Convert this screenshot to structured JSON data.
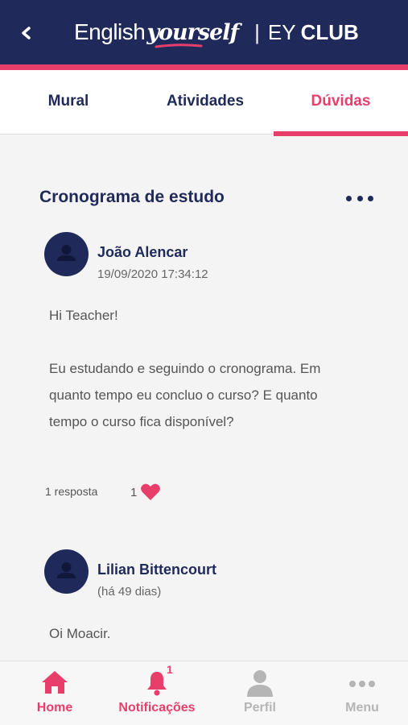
{
  "header": {
    "back_icon": "chevron-left-icon",
    "logo_english": "English",
    "logo_yourself": "yourself",
    "logo_separator": "|",
    "logo_ey": "EY",
    "logo_club": "CLUB"
  },
  "tabs": [
    {
      "label": "Mural",
      "active": false
    },
    {
      "label": "Atividades",
      "active": false
    },
    {
      "label": "Dúvidas",
      "active": true
    }
  ],
  "post": {
    "title": "Cronograma de estudo",
    "more_icon": "more-horizontal-icon",
    "author": "João Alencar",
    "timestamp": "19/09/2020 17:34:12",
    "greeting": "Hi Teacher!",
    "body_line1": "Eu estudando e seguindo o cronograma. Em",
    "body_line2": "quanto tempo eu concluo o curso? E quanto",
    "body_line3": "tempo o curso fica disponível?",
    "replies": "1 resposta",
    "likes": "1",
    "like_icon": "heart-icon"
  },
  "reply": {
    "author": "Lilian Bittencourt",
    "timestamp": "(há 49 dias)",
    "body": "Oi Moacir."
  },
  "bottom_nav": {
    "home": "Home",
    "notifications": "Notificações",
    "notifications_badge": "1",
    "profile": "Perfil",
    "menu": "Menu"
  },
  "colors": {
    "navy": "#1f2a5a",
    "pink": "#e83e6c",
    "inactive": "#b5b5b5"
  }
}
